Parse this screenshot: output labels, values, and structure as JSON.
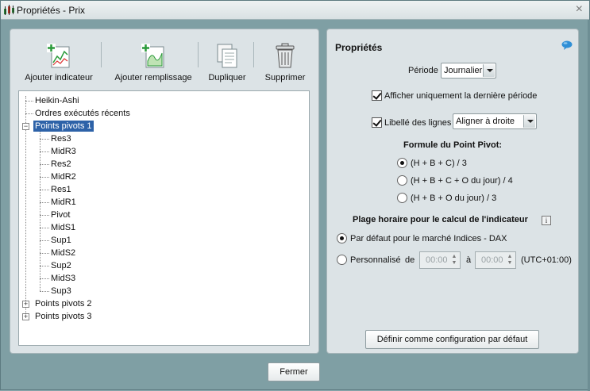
{
  "window": {
    "title": "Propriétés - Prix",
    "close_label": "×"
  },
  "toolbar": {
    "add_indicator": "Ajouter indicateur",
    "add_fill": "Ajouter remplissage",
    "duplicate": "Dupliquer",
    "delete": "Supprimer"
  },
  "tree": {
    "items": [
      {
        "label": "Heikin-Ashi"
      },
      {
        "label": "Ordres exécutés récents"
      },
      {
        "label": "Points pivots 1"
      },
      {
        "label": "Points pivots 2"
      },
      {
        "label": "Points pivots 3"
      }
    ],
    "children": [
      "Res3",
      "MidR3",
      "Res2",
      "MidR2",
      "Res1",
      "MidR1",
      "Pivot",
      "MidS1",
      "Sup1",
      "MidS2",
      "Sup2",
      "MidS3",
      "Sup3"
    ]
  },
  "properties": {
    "title": "Propriétés",
    "period_label": "Période",
    "period_value": "Journalier",
    "show_last_period": "Afficher uniquement la dernière période",
    "line_labels": "Libellé des lignes",
    "line_labels_value": "Aligner à droite",
    "formula_title": "Formule du Point Pivot:",
    "formula_options": [
      "(H + B + C) / 3",
      "(H + B + C + O du jour) / 4",
      "(H + B + O du jour) / 3"
    ],
    "range_title": "Plage horaire pour le calcul de l'indicateur",
    "info_glyph": "i",
    "default_market": "Par défaut pour le marché Indices - DAX",
    "custom_label": "Personnalisé",
    "from_label": "de",
    "from_time": "00:00",
    "to_label": "à",
    "to_time": "00:00",
    "timezone": "(UTC+01:00)",
    "set_default_button": "Définir comme configuration par défaut"
  },
  "footer": {
    "close_button": "Fermer"
  },
  "colors": {
    "selection": "#2d62a8",
    "dialog_bg": "#7f9fa4",
    "panel_bg": "#dce3e6",
    "help_icon": "#2f8fd6"
  }
}
